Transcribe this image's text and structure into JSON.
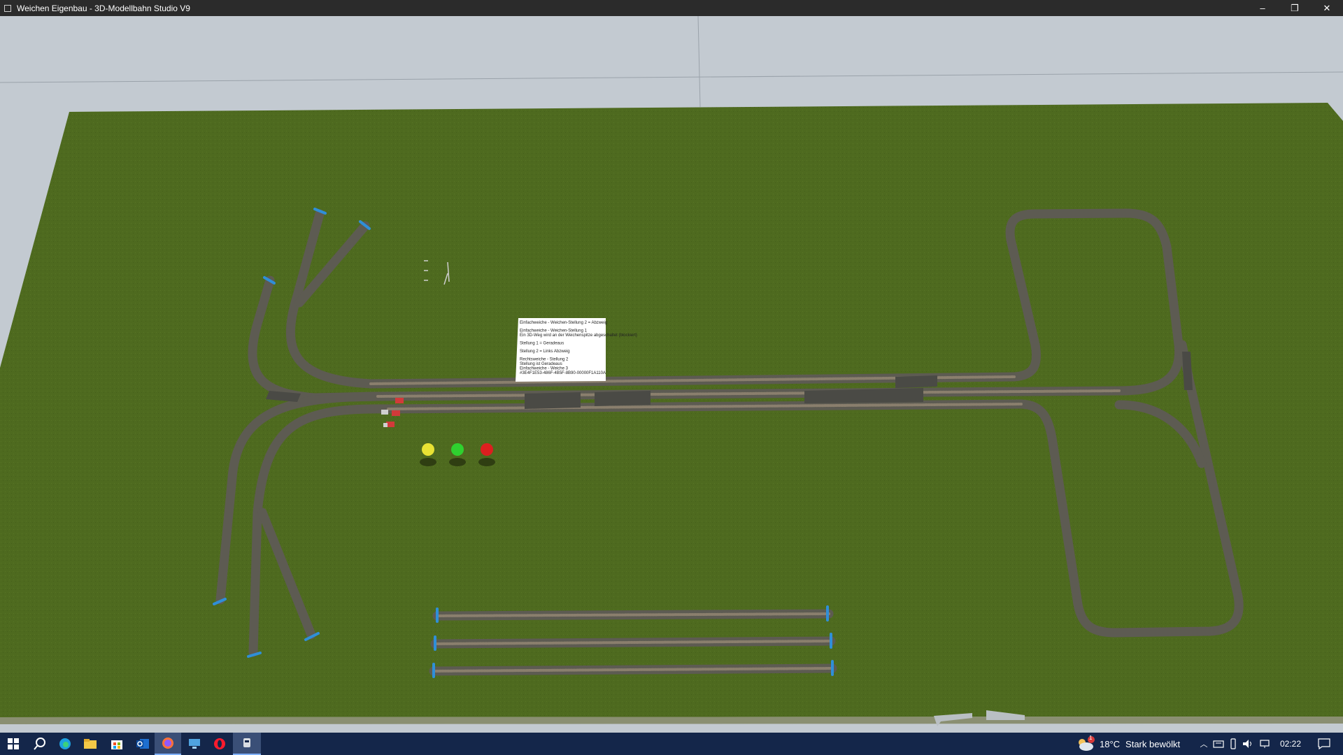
{
  "window": {
    "title": "Weichen Eigenbau - 3D-Modellbahn Studio V9",
    "minimize": "–",
    "restore": "❐",
    "close": "✕"
  },
  "note": {
    "lines": [
      "Einfachweiche - Weichen-Stellung 2 = Abzweig",
      "",
      "Einfachweiche - Weichen-Stellung 1",
      "Ein 3D-Weg wird an der Weichenspitze abgeschaltet (blockiert)",
      "",
      "Stellung 1 = Geradeaus",
      "",
      "Stellung 2 = Links Abzweig",
      "",
      "Rechtsweiche - Stellung 2",
      "Stellung ist Geradeaus",
      "Einfachweiche - Weiche 3",
      "#3E4F1E53-486F-4B5F-8B90-00000F1A110A"
    ]
  },
  "signals": [
    {
      "name": "yellow",
      "color": "#e8e234"
    },
    {
      "name": "green",
      "color": "#2fd12f"
    },
    {
      "name": "red",
      "color": "#dc1f1f"
    }
  ],
  "colors": {
    "ground": "#4e6a1f",
    "sky": "#c3cad1",
    "track": "#6d6a5e",
    "taskbar": "#14264a"
  },
  "taskbar": {
    "weather_badge": "1",
    "weather_temp": "18°C",
    "weather_text": "Stark bewölkt",
    "clock": "02:22",
    "apps": [
      "start-icon",
      "search-icon",
      "edge-icon",
      "file-explorer-icon",
      "store-icon",
      "outlook-icon",
      "firefox-icon",
      "remote-desktop-icon",
      "opera-icon",
      "modellbahn-studio-icon"
    ]
  }
}
